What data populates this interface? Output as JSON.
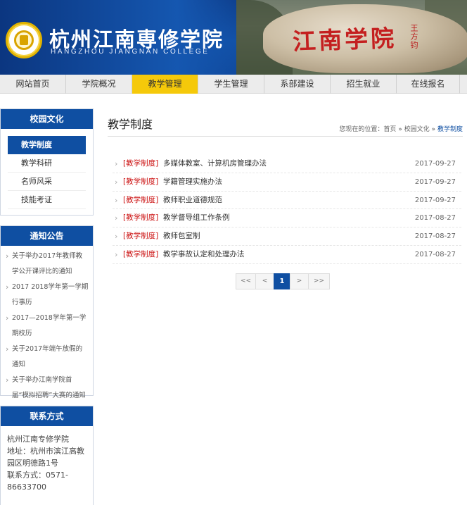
{
  "header": {
    "school_cn": "杭州江南専修学院",
    "school_en": "HANGZHOU JIANGNAN COLLEGE",
    "stone_text": "江南学院",
    "stone_sign": "王方钧"
  },
  "nav": [
    {
      "label": "网站首页"
    },
    {
      "label": "学院概况"
    },
    {
      "label": "教学管理",
      "active": true
    },
    {
      "label": "学生管理"
    },
    {
      "label": "系部建设"
    },
    {
      "label": "招生就业"
    },
    {
      "label": "在线报名"
    }
  ],
  "sidebar": {
    "culture": {
      "title": "校园文化",
      "items": [
        {
          "label": "教学制度",
          "active": true
        },
        {
          "label": "教学科研"
        },
        {
          "label": "名师风采"
        },
        {
          "label": "技能考证"
        }
      ]
    },
    "notice": {
      "title": "通知公告",
      "items": [
        {
          "text": "关于举办2017年教师教学公开课评比的通知"
        },
        {
          "text": "2017 2018学年第一学期行事历"
        },
        {
          "text": "2017—2018学年第一学期校历"
        },
        {
          "text": "关于2017年端午放假的通知"
        },
        {
          "text": "关于举办江南学院首届“模拟招聘”大赛的通知"
        }
      ]
    },
    "contact": {
      "title": "联系方式",
      "name": "杭州江南专修学院",
      "address": "地址：杭州市滨江高教园区明德路1号",
      "phone": "联系方式：0571-86633700"
    }
  },
  "main": {
    "title": "教学制度",
    "breadcrumb": {
      "prefix": "您现在的位置：",
      "home": "首页",
      "sep": "»",
      "parent": "校园文化",
      "current": "教学制度"
    },
    "articles": [
      {
        "category": "[教学制度]",
        "title": "多媒体教室、计算机房管理办法",
        "date": "2017-09-27"
      },
      {
        "category": "[教学制度]",
        "title": "学籍管理实施办法",
        "date": "2017-09-27"
      },
      {
        "category": "[教学制度]",
        "title": "教师职业道德规范",
        "date": "2017-09-27"
      },
      {
        "category": "[教学制度]",
        "title": "教学督导组工作条例",
        "date": "2017-08-27"
      },
      {
        "category": "[教学制度]",
        "title": "教师包室制",
        "date": "2017-08-27"
      },
      {
        "category": "[教学制度]",
        "title": "教学事故认定和处理办法",
        "date": "2017-08-27"
      }
    ],
    "pager": {
      "first": "<<",
      "prev": "<",
      "current": "1",
      "next": ">",
      "last": ">>"
    }
  },
  "colors": {
    "brand_blue": "#0f4fa2",
    "nav_active": "#f5c90a",
    "category_red": "#cc1111"
  }
}
